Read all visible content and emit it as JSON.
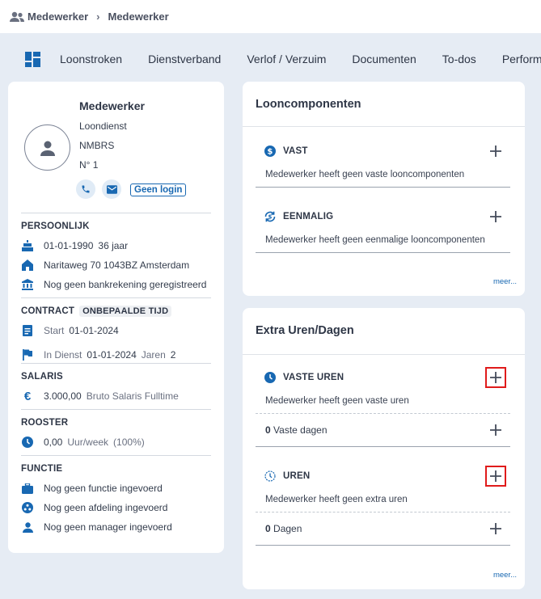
{
  "breadcrumb": {
    "root": "Medewerker",
    "current": "Medewerker",
    "icon": "users-icon"
  },
  "nav": {
    "tabs": [
      "Loonstroken",
      "Dienstverband",
      "Verlof / Verzuim",
      "Documenten",
      "To-dos",
      "Performance"
    ]
  },
  "profile": {
    "name": "Medewerker",
    "employer": "Loondienst",
    "company": "NMBRS",
    "number": "N° 1",
    "login_label": "Geen login",
    "persoonlijk": {
      "title": "PERSOONLIJK",
      "birthdate": "01-01-1990",
      "age": "36 jaar",
      "address": "Naritaweg 70 1043BZ Amsterdam",
      "bank": "Nog geen bankrekening geregistreerd"
    },
    "contract": {
      "title": "CONTRACT",
      "type": "ONBEPAALDE TIJD",
      "start_label": "Start",
      "start_value": "01-01-2024",
      "indienst_label": "In Dienst",
      "indienst_value": "01-01-2024",
      "jaren_label": "Jaren",
      "jaren_value": "2"
    },
    "salaris": {
      "title": "SALARIS",
      "amount": "3.000,00",
      "label": "Bruto Salaris Fulltime"
    },
    "rooster": {
      "title": "ROOSTER",
      "value": "0,00",
      "unit": "Uur/week",
      "pct": "(100%)"
    },
    "functie": {
      "title": "FUNCTIE",
      "functie": "Nog geen functie ingevoerd",
      "afdeling": "Nog geen afdeling ingevoerd",
      "manager": "Nog geen manager ingevoerd"
    }
  },
  "looncomponenten": {
    "title": "Looncomponenten",
    "vast": {
      "label": "VAST",
      "note": "Medewerker heeft geen vaste looncomponenten"
    },
    "eenmalig": {
      "label": "EENMALIG",
      "note": "Medewerker heeft geen eenmalige looncomponenten"
    },
    "meer": "meer..."
  },
  "extra": {
    "title": "Extra Uren/Dagen",
    "vaste_uren": {
      "label": "VASTE UREN",
      "note": "Medewerker heeft geen vaste uren",
      "count": "0",
      "count_label": "Vaste dagen"
    },
    "uren": {
      "label": "UREN",
      "note": "Medewerker heeft geen extra uren",
      "count": "0",
      "count_label": "Dagen"
    },
    "meer": "meer..."
  },
  "colors": {
    "accent": "#1868b2",
    "background": "#e6ecf4",
    "highlight": "#e01b1b"
  }
}
